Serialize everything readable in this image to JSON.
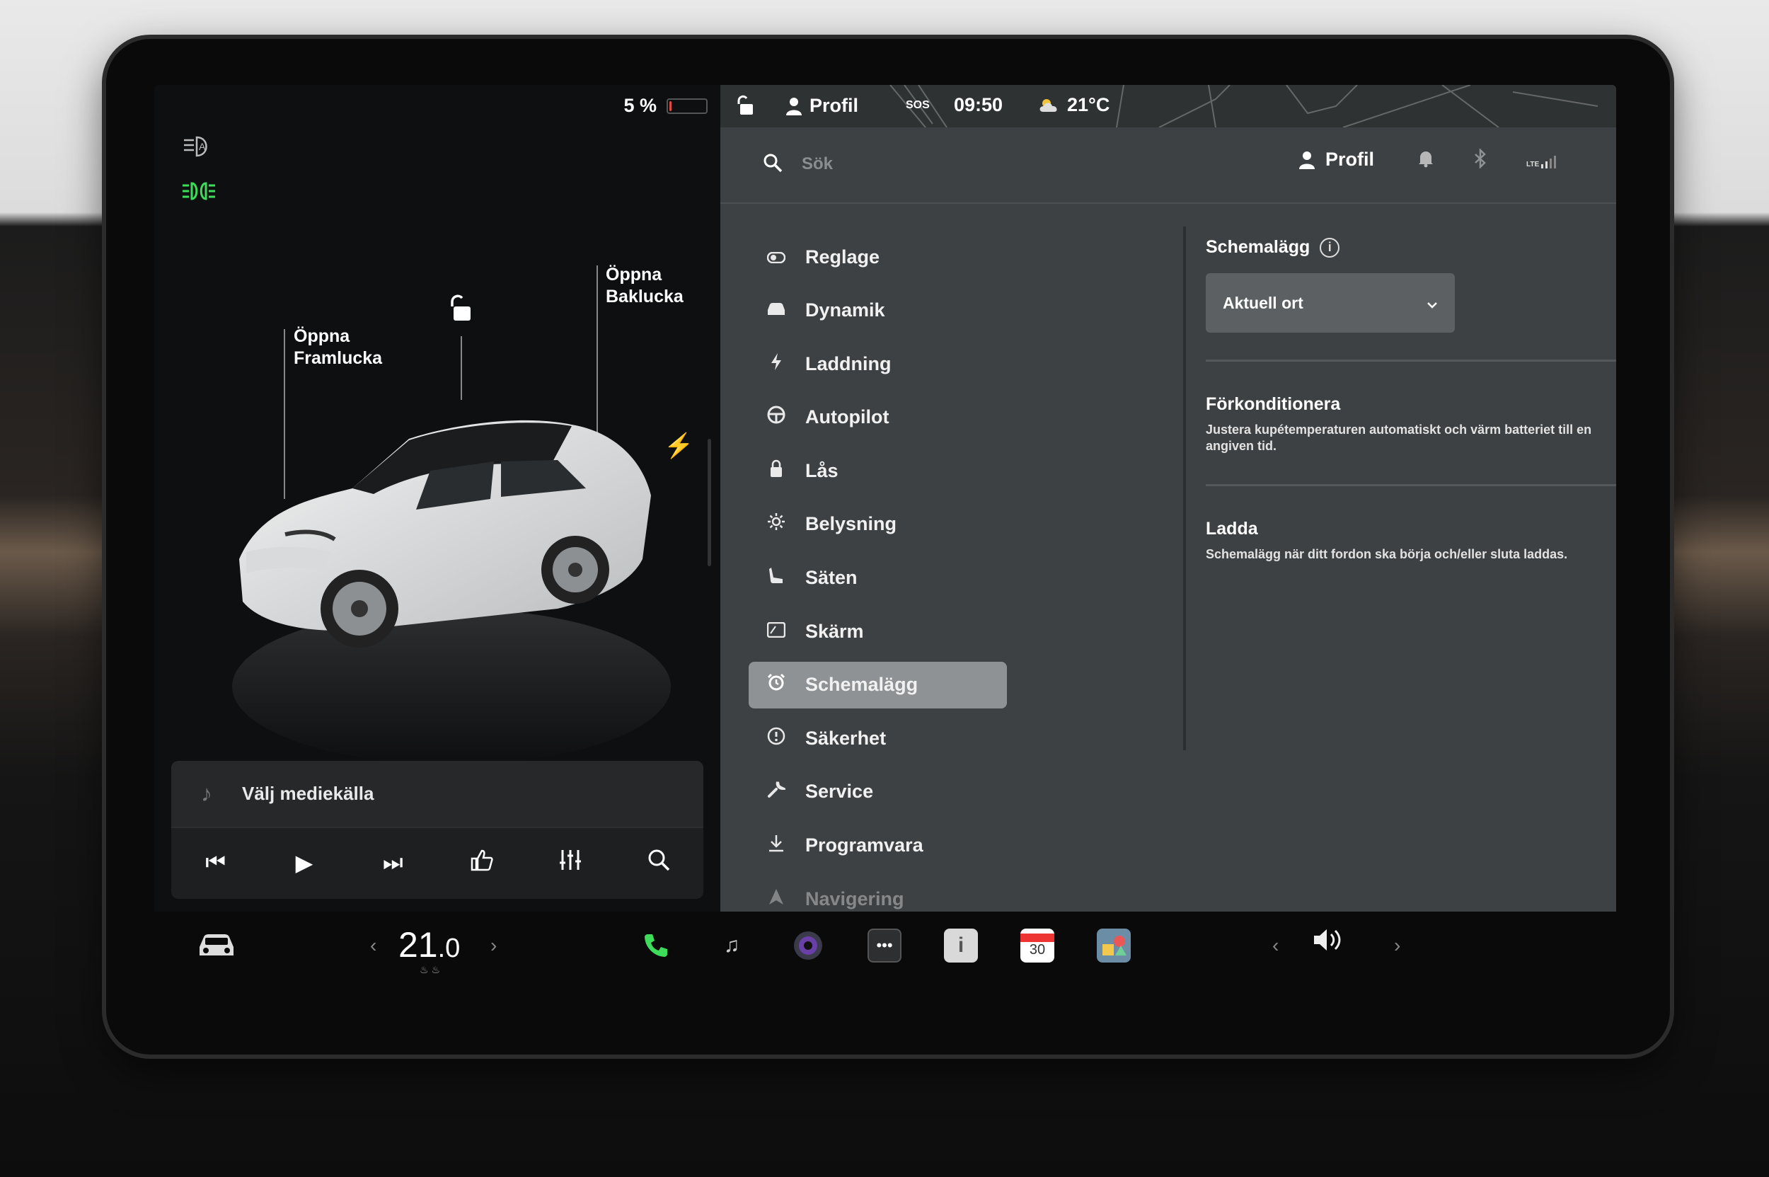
{
  "left_status": {
    "battery_percent": "5 %",
    "battery_level": 0.05
  },
  "car_labels": {
    "frunk_line1": "Öppna",
    "frunk_line2": "Framlucka",
    "trunk_line1": "Öppna",
    "trunk_line2": "Baklucka"
  },
  "media": {
    "source_label": "Välj mediekälla"
  },
  "topbar": {
    "profile": "Profil",
    "sos": "SOS",
    "time": "09:50",
    "temperature": "21°C"
  },
  "search": {
    "placeholder": "Sök"
  },
  "header_right": {
    "profile": "Profil",
    "signal": "LTE"
  },
  "menu": {
    "items": [
      {
        "label": "Reglage",
        "icon": "toggle-icon"
      },
      {
        "label": "Dynamik",
        "icon": "car-icon"
      },
      {
        "label": "Laddning",
        "icon": "bolt-icon"
      },
      {
        "label": "Autopilot",
        "icon": "steering-wheel-icon"
      },
      {
        "label": "Lås",
        "icon": "lock-icon"
      },
      {
        "label": "Belysning",
        "icon": "sun-icon"
      },
      {
        "label": "Säten",
        "icon": "seat-icon"
      },
      {
        "label": "Skärm",
        "icon": "display-icon"
      },
      {
        "label": "Schemalägg",
        "icon": "alarm-clock-icon",
        "active": true
      },
      {
        "label": "Säkerhet",
        "icon": "alert-circle-icon"
      },
      {
        "label": "Service",
        "icon": "wrench-icon"
      },
      {
        "label": "Programvara",
        "icon": "download-icon"
      },
      {
        "label": "Navigering",
        "icon": "navigation-icon"
      }
    ]
  },
  "schedule": {
    "title": "Schemalägg",
    "location_select": "Aktuell ort",
    "precondition": {
      "title": "Förkonditionera",
      "desc": "Justera kupétemperaturen automatiskt och värm batteriet till en angiven tid."
    },
    "charge": {
      "title": "Ladda",
      "desc": "Schemalägg när ditt fordon ska börja och/eller sluta laddas."
    }
  },
  "dock": {
    "temp_main": "21",
    "temp_decimal": ".0",
    "calendar_day": "30"
  },
  "colors": {
    "accent_green": "#3ddc5a",
    "active_menu_bg": "#8f9294",
    "panel_bg": "#3e4143",
    "battery_low": "#e64a3c"
  }
}
